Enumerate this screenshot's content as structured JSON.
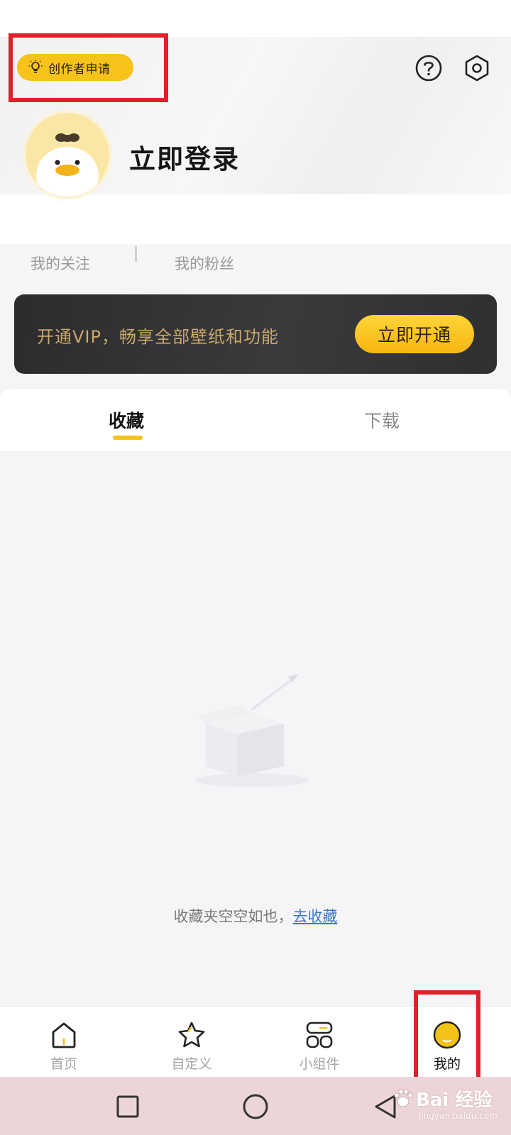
{
  "header": {
    "creator_button": "创作者申请",
    "login_title": "立即登录"
  },
  "stats": {
    "following_label": "我的关注",
    "fans_label": "我的粉丝"
  },
  "vip_banner": {
    "text": "开通VIP，畅享全部壁纸和功能",
    "button": "立即开通"
  },
  "tabs": [
    {
      "label": "收藏",
      "active": true
    },
    {
      "label": "下载",
      "active": false
    }
  ],
  "empty_state": {
    "message": "收藏夹空空如也，",
    "link": "去收藏"
  },
  "bottom_nav": [
    {
      "label": "首页",
      "icon": "home-icon"
    },
    {
      "label": "自定义",
      "icon": "star-icon"
    },
    {
      "label": "小组件",
      "icon": "widget-icon"
    },
    {
      "label": "我的",
      "icon": "profile-icon",
      "active": true
    }
  ],
  "watermark": {
    "main": "Bai 经验",
    "sub": "jingyan.baidu.com"
  },
  "colors": {
    "accent_yellow": "#f4c317",
    "highlight_red": "#e0202a",
    "vip_gold": "#c9a86a",
    "link_blue": "#3a78c8"
  }
}
